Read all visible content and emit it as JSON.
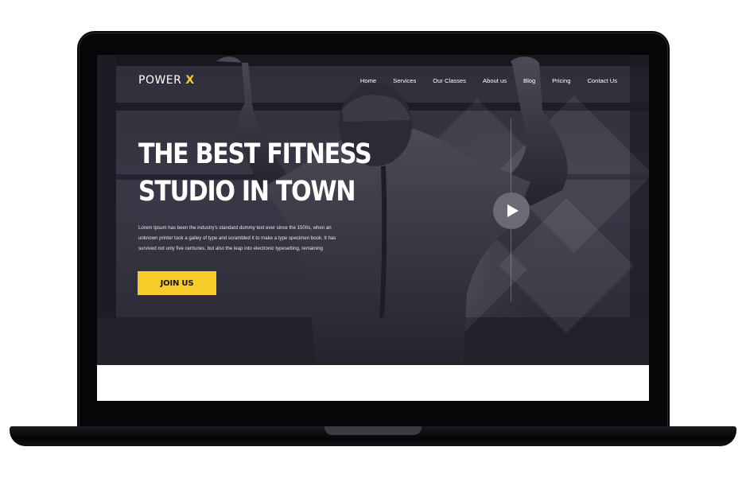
{
  "brand": {
    "name": "POWER",
    "accent": "X",
    "accent_color": "#f7cc2a"
  },
  "nav": {
    "items": [
      "Home",
      "Services",
      "Our Classes",
      "About us",
      "Blog",
      "Pricing",
      "Contact Us"
    ]
  },
  "hero": {
    "title_line1": "THE BEST FITNESS",
    "title_line2": "STUDIO IN TOWN",
    "description": "Lorem Ipsum has been the industry's standard dummy text ever since the 1500s, when an unknown printer took a galley of type and scrambled it to make a type specimen book. It has survived not only five centuries, but also the leap into electronic typesetting, remaining",
    "cta_label": "JOIN US",
    "play_icon": "play-icon"
  }
}
